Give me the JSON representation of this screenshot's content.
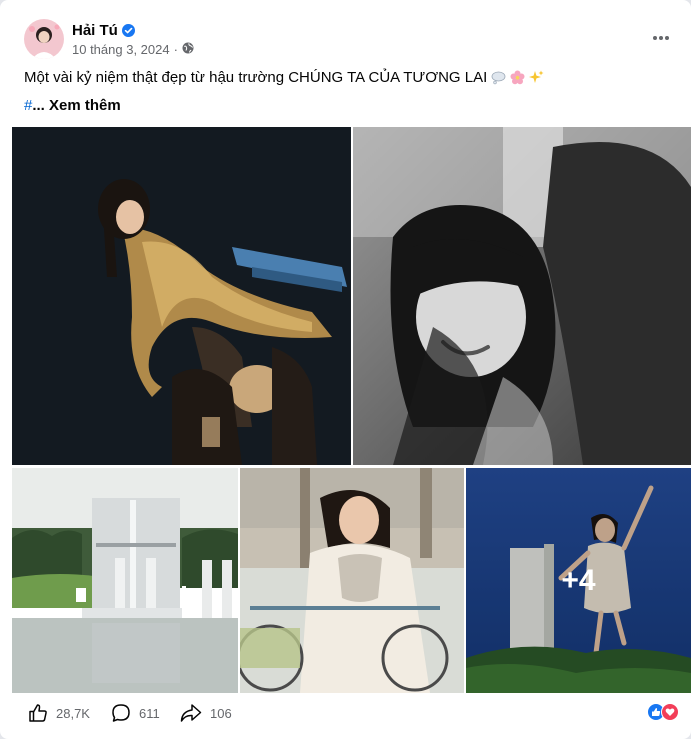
{
  "post": {
    "author": "Hải Tú",
    "date": "10 tháng 3, 2024",
    "dot": "·",
    "caption": "Một vài kỷ niệm thật đẹp từ hậu trường CHÚNG TA CỦA TƯƠNG LAI",
    "hash": "#",
    "see_more": "... Xem thêm",
    "extra_photos": "+4"
  },
  "stats": {
    "likes": "28,7K",
    "comments": "611",
    "shares": "106"
  },
  "colors": {
    "accent": "#1877f2",
    "love": "#f33e58",
    "secondary_text": "#65676b"
  }
}
